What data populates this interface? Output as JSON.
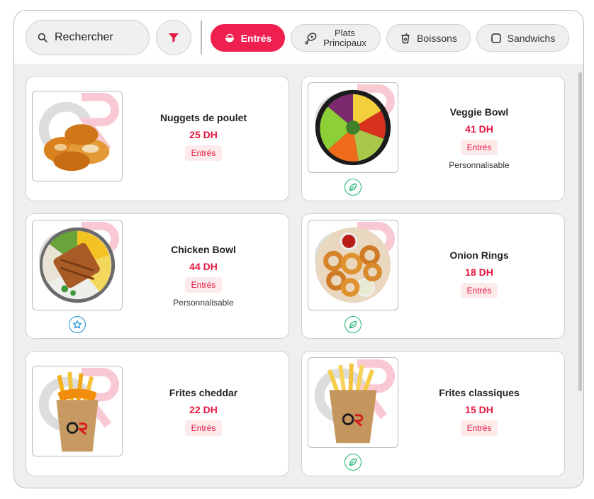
{
  "search": {
    "placeholder": "Rechercher"
  },
  "categories": [
    {
      "label": "Entrés",
      "icon": "bowl-icon",
      "active": true
    },
    {
      "label_line1": "Plats",
      "label_line2": "Principaux",
      "icon": "meat-icon",
      "active": false
    },
    {
      "label": "Boissons",
      "icon": "cup-icon",
      "active": false
    },
    {
      "label": "Sandwichs",
      "icon": "square-icon",
      "active": false
    }
  ],
  "products": [
    {
      "name": "Nuggets de poulet",
      "price": "25 DH",
      "tag": "Entrés",
      "image": "nuggets-image"
    },
    {
      "name": "Veggie Bowl",
      "price": "41 DH",
      "tag": "Entrés",
      "note": "Personnalisable",
      "badge": "leaf-icon",
      "image": "veggie-bowl-image"
    },
    {
      "name": "Chicken Bowl",
      "price": "44 DH",
      "tag": "Entrés",
      "note": "Personnalisable",
      "badge": "star-icon",
      "image": "chicken-bowl-image"
    },
    {
      "name": "Onion Rings",
      "price": "18 DH",
      "tag": "Entrés",
      "badge": "leaf-icon",
      "image": "onion-rings-image"
    },
    {
      "name": "Frites cheddar",
      "price": "22 DH",
      "tag": "Entrés",
      "image": "cheddar-fries-image"
    },
    {
      "name": "Frites classiques",
      "price": "15 DH",
      "tag": "Entrés",
      "badge": "leaf-icon",
      "image": "classic-fries-image"
    }
  ],
  "colors": {
    "accent": "#ef2050",
    "price": "#e5163f",
    "tag_bg": "#fdeaea",
    "leaf": "#1fb36f",
    "star": "#1b8fd1"
  }
}
